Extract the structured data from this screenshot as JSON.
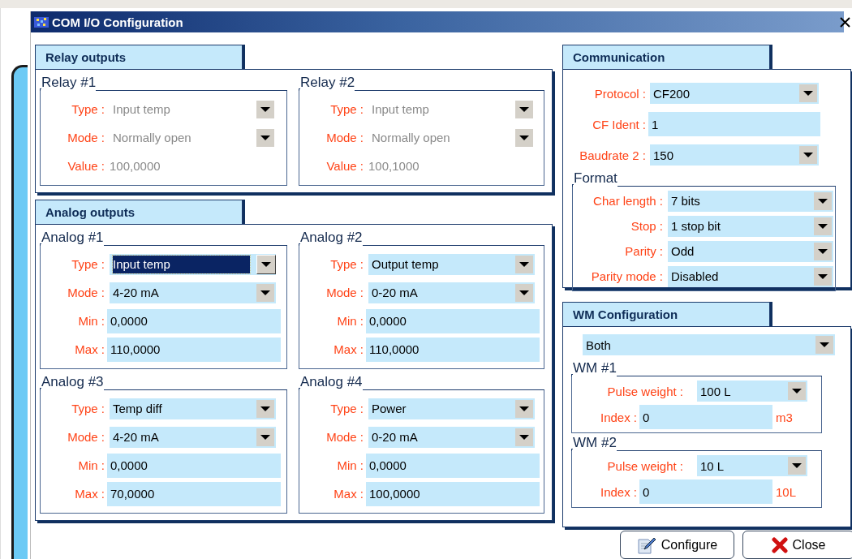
{
  "window": {
    "title": "COM I/O Configuration"
  },
  "relay_outputs": {
    "title": "Relay outputs",
    "groups": [
      {
        "title": "Relay #1",
        "disabled": true,
        "fields": [
          {
            "kind": "dropdown",
            "label": "Type :",
            "value": "Input temp"
          },
          {
            "kind": "dropdown",
            "label": "Mode :",
            "value": "Normally open"
          },
          {
            "kind": "plain",
            "label": "Value :",
            "value": "100,0000"
          }
        ]
      },
      {
        "title": "Relay #2",
        "disabled": true,
        "fields": [
          {
            "kind": "dropdown",
            "label": "Type :",
            "value": "Input temp"
          },
          {
            "kind": "dropdown",
            "label": "Mode :",
            "value": "Normally open"
          },
          {
            "kind": "plain",
            "label": "Value :",
            "value": "100,1000"
          }
        ]
      }
    ]
  },
  "analog_outputs": {
    "title": "Analog outputs",
    "groups": [
      {
        "title": "Analog #1",
        "disabled": false,
        "fields": [
          {
            "kind": "dropdown",
            "label": "Type :",
            "value": "Input temp",
            "focused": true
          },
          {
            "kind": "dropdown",
            "label": "Mode :",
            "value": "4-20 mA",
            "focused": false
          },
          {
            "kind": "text",
            "label": "Min :",
            "value": "0,0000",
            "focused": false
          },
          {
            "kind": "text",
            "label": "Max :",
            "value": "110,0000",
            "focused": false
          }
        ]
      },
      {
        "title": "Analog #2",
        "disabled": false,
        "fields": [
          {
            "kind": "dropdown",
            "label": "Type :",
            "value": "Output temp",
            "focused": false
          },
          {
            "kind": "dropdown",
            "label": "Mode :",
            "value": "0-20 mA",
            "focused": false
          },
          {
            "kind": "text",
            "label": "Min :",
            "value": "0,0000",
            "focused": false
          },
          {
            "kind": "text",
            "label": "Max :",
            "value": "110,0000",
            "focused": false
          }
        ]
      },
      {
        "title": "Analog #3",
        "disabled": false,
        "fields": [
          {
            "kind": "dropdown",
            "label": "Type :",
            "value": "Temp diff",
            "focused": false
          },
          {
            "kind": "dropdown",
            "label": "Mode :",
            "value": "4-20 mA",
            "focused": false
          },
          {
            "kind": "text",
            "label": "Min :",
            "value": "0,0000",
            "focused": false
          },
          {
            "kind": "text",
            "label": "Max :",
            "value": "70,0000",
            "focused": false
          }
        ]
      },
      {
        "title": "Analog #4",
        "disabled": false,
        "fields": [
          {
            "kind": "dropdown",
            "label": "Type :",
            "value": "Power",
            "focused": false
          },
          {
            "kind": "dropdown",
            "label": "Mode :",
            "value": "0-20 mA",
            "focused": false
          },
          {
            "kind": "text",
            "label": "Min :",
            "value": "0,0000",
            "focused": false
          },
          {
            "kind": "text",
            "label": "Max :",
            "value": "100,0000",
            "focused": false
          }
        ]
      }
    ]
  },
  "communication": {
    "title": "Communication",
    "fields": [
      {
        "kind": "dropdown",
        "label": "Protocol :",
        "value": "CF200"
      },
      {
        "kind": "text",
        "label": "CF Ident :",
        "value": "1"
      },
      {
        "kind": "dropdown",
        "label": "Baudrate 2 :",
        "value": "150"
      }
    ],
    "format": {
      "title": "Format",
      "fields": [
        {
          "kind": "dropdown",
          "label": "Char length :",
          "value": "7 bits"
        },
        {
          "kind": "dropdown",
          "label": "Stop :",
          "value": "1 stop bit"
        },
        {
          "kind": "dropdown",
          "label": "Parity :",
          "value": "Odd"
        },
        {
          "kind": "dropdown",
          "label": "Parity mode :",
          "value": "Disabled"
        }
      ]
    }
  },
  "wm_configuration": {
    "title": "WM Configuration",
    "mode": {
      "value": "Both"
    },
    "groups": [
      {
        "title": "WM #1",
        "fields": [
          {
            "kind": "dropdown",
            "label": "Pulse weight :",
            "value": "100 L"
          },
          {
            "kind": "text",
            "label": "Index :",
            "value": "0",
            "unit": "m3"
          }
        ]
      },
      {
        "title": "WM #2",
        "fields": [
          {
            "kind": "dropdown",
            "label": "Pulse weight :",
            "value": "10 L"
          },
          {
            "kind": "text",
            "label": "Index :",
            "value": "0",
            "unit": "10L"
          }
        ]
      }
    ]
  },
  "buttons": [
    {
      "kind": "configure",
      "label": "Configure"
    },
    {
      "kind": "close",
      "label": "Close"
    }
  ]
}
